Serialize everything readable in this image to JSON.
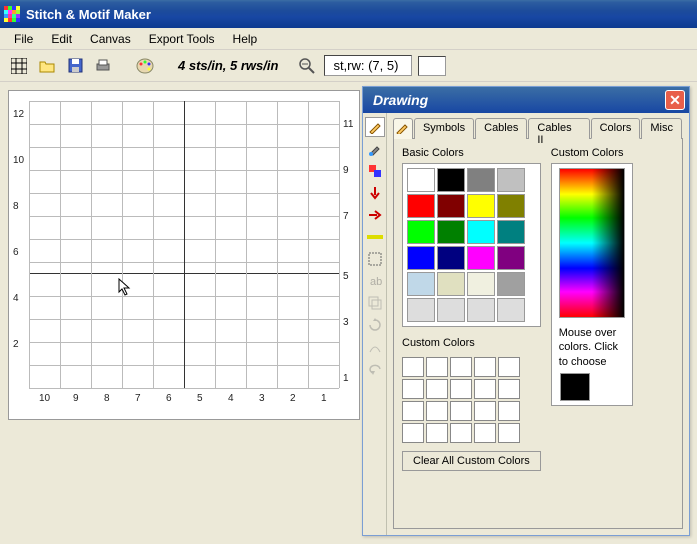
{
  "app": {
    "title": "Stitch & Motif Maker"
  },
  "menu": [
    "File",
    "Edit",
    "Canvas",
    "Export Tools",
    "Help"
  ],
  "toolbar": {
    "stitch_info": "4 sts/in, 5 rws/in",
    "coord": "st,rw: (7, 5)"
  },
  "axis": {
    "y": [
      "12",
      "10",
      "8",
      "6",
      "4",
      "2"
    ],
    "yr": [
      "11",
      "9",
      "7",
      "5",
      "3",
      "1"
    ],
    "x": [
      "10",
      "9",
      "8",
      "7",
      "6",
      "5",
      "4",
      "3",
      "2",
      "1"
    ]
  },
  "drawing": {
    "title": "Drawing",
    "tabs": [
      "Symbols",
      "Cables",
      "Cables II",
      "Colors",
      "Misc"
    ],
    "basic_label": "Basic Colors",
    "custom_label_top": "Custom Colors",
    "custom_label": "Custom Colors",
    "help": "Mouse over colors. Click to choose",
    "clear": "Clear All Custom Colors",
    "basic_colors": [
      "#ffffff",
      "#000000",
      "#808080",
      "#c0c0c0",
      "#ff0000",
      "#800000",
      "#ffff00",
      "#808000",
      "#00ff00",
      "#008000",
      "#00ffff",
      "#008080",
      "#0000ff",
      "#000080",
      "#ff00ff",
      "#800080",
      "#c0d8e8",
      "#e0e0c0",
      "#f0f0e0",
      "#a0a0a0"
    ]
  }
}
